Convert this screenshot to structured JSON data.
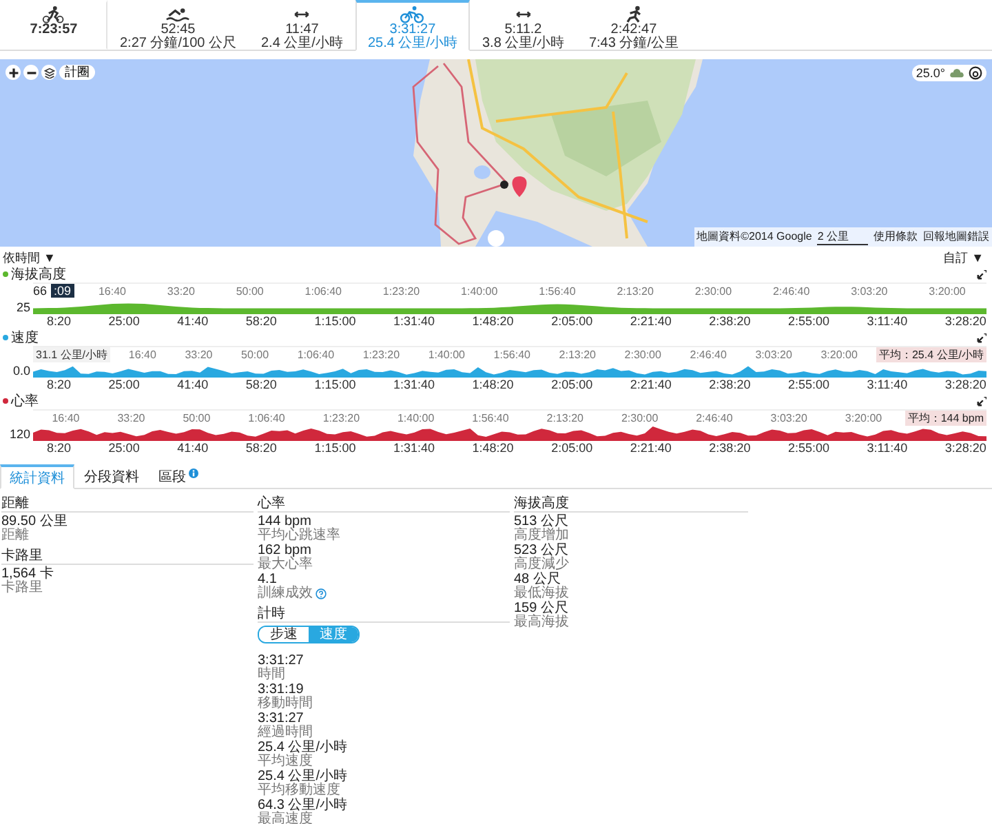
{
  "activity_tabs": [
    {
      "kind": "multisport",
      "time": "7:23:57",
      "selected": false
    },
    {
      "kind": "swim",
      "time": "52:45",
      "pace": "2:27 分鐘/100 公尺",
      "selected": false
    },
    {
      "kind": "transition",
      "time": "11:47",
      "pace": "2.4 公里/小時",
      "selected": false
    },
    {
      "kind": "bike",
      "time": "3:31:27",
      "pace": "25.4 公里/小時",
      "selected": true
    },
    {
      "kind": "transition",
      "time": "5:11.2",
      "pace": "3.8 公里/小時",
      "selected": false
    },
    {
      "kind": "run",
      "time": "2:42:47",
      "pace": "7:43 分鐘/公里",
      "selected": false
    }
  ],
  "map": {
    "laps_button": "計圈",
    "temperature": "25.0°",
    "attribution": "地圖資料©2014 Google",
    "scale": "2 公里",
    "terms": "使用條款",
    "report": "回報地圖錯誤"
  },
  "chart_controls": {
    "x_mode": "依時間 ▼",
    "custom": "自訂 ▼"
  },
  "charts": [
    {
      "title": "海拔高度",
      "color": "#5cb82e",
      "y_label": "25",
      "marker_value": "66",
      "marker_time": ":09",
      "top_ticks": [
        "16:40",
        "33:20",
        "50:00",
        "1:06:40",
        "1:23:20",
        "1:40:00",
        "1:56:40",
        "2:13:20",
        "2:30:00",
        "2:46:40",
        "3:03:20",
        "3:20:00"
      ],
      "bottom_ticks": [
        "8:20",
        "25:00",
        "41:40",
        "58:20",
        "1:15:00",
        "1:31:40",
        "1:48:20",
        "2:05:00",
        "2:21:40",
        "2:38:20",
        "2:55:00",
        "3:11:40",
        "3:28:20"
      ]
    },
    {
      "title": "速度",
      "color": "#29a8e0",
      "y_label": "0.0",
      "tooltip": "31.1 公里/小時",
      "average": "平均：25.4 公里/小時",
      "top_ticks": [
        "16:40",
        "33:20",
        "50:00",
        "1:06:40",
        "1:23:20",
        "1:40:00",
        "1:56:40",
        "2:13:20",
        "2:30:00",
        "2:46:40",
        "3:03:20",
        "3:20:00"
      ],
      "bottom_ticks": [
        "8:20",
        "25:00",
        "41:40",
        "58:20",
        "1:15:00",
        "1:31:40",
        "1:48:20",
        "2:05:00",
        "2:21:40",
        "2:38:20",
        "2:55:00",
        "3:11:40",
        "3:28:20"
      ]
    },
    {
      "title": "心率",
      "color": "#d0283c",
      "y_label": "120",
      "average": "平均：144 bpm",
      "top_ticks": [
        "16:40",
        "33:20",
        "50:00",
        "1:06:40",
        "1:23:20",
        "1:40:00",
        "1:56:40",
        "2:13:20",
        "2:30:00",
        "2:46:40",
        "3:03:20",
        "3:20:00"
      ],
      "bottom_ticks": [
        "8:20",
        "25:00",
        "41:40",
        "58:20",
        "1:15:00",
        "1:31:40",
        "1:48:20",
        "2:05:00",
        "2:21:40",
        "2:38:20",
        "2:55:00",
        "3:11:40",
        "3:28:20"
      ]
    }
  ],
  "stats_tabs": [
    {
      "label": "統計資料",
      "selected": true,
      "info": false
    },
    {
      "label": "分段資料",
      "selected": false,
      "info": false
    },
    {
      "label": "區段",
      "selected": false,
      "info": true
    }
  ],
  "stats_columns": [
    [
      {
        "title": "距離",
        "items": [
          {
            "value": "89.50 公里",
            "label": "距離",
            "help": false
          }
        ]
      },
      {
        "title": "卡路里",
        "items": [
          {
            "value": "1,564 卡",
            "label": "卡路里",
            "help": false
          }
        ]
      }
    ],
    [
      {
        "title": "心率",
        "items": [
          {
            "value": "144 bpm",
            "label": "平均心跳速率",
            "help": false
          },
          {
            "value": "162 bpm",
            "label": "最大心率",
            "help": false
          },
          {
            "value": "4.1",
            "label": "訓練成效",
            "help": true
          }
        ]
      },
      {
        "title": "計時",
        "toggle": [
          {
            "label": "步速",
            "selected": false
          },
          {
            "label": "速度",
            "selected": true
          }
        ],
        "items": [
          {
            "value": "3:31:27",
            "label": "時間",
            "help": false
          },
          {
            "value": "3:31:19",
            "label": "移動時間",
            "help": false
          },
          {
            "value": "3:31:27",
            "label": "經過時間",
            "help": false
          },
          {
            "value": "25.4 公里/小時",
            "label": "平均速度",
            "help": false
          },
          {
            "value": "25.4 公里/小時",
            "label": "平均移動速度",
            "help": false
          },
          {
            "value": "64.3 公里/小時",
            "label": "最高速度",
            "help": false
          }
        ]
      }
    ],
    [
      {
        "title": "海拔高度",
        "items": [
          {
            "value": "513 公尺",
            "label": "高度增加",
            "help": false
          },
          {
            "value": "523 公尺",
            "label": "高度減少",
            "help": false
          },
          {
            "value": "48 公尺",
            "label": "最低海拔",
            "help": false
          },
          {
            "value": "159 公尺",
            "label": "最高海拔",
            "help": false
          }
        ]
      }
    ]
  ]
}
